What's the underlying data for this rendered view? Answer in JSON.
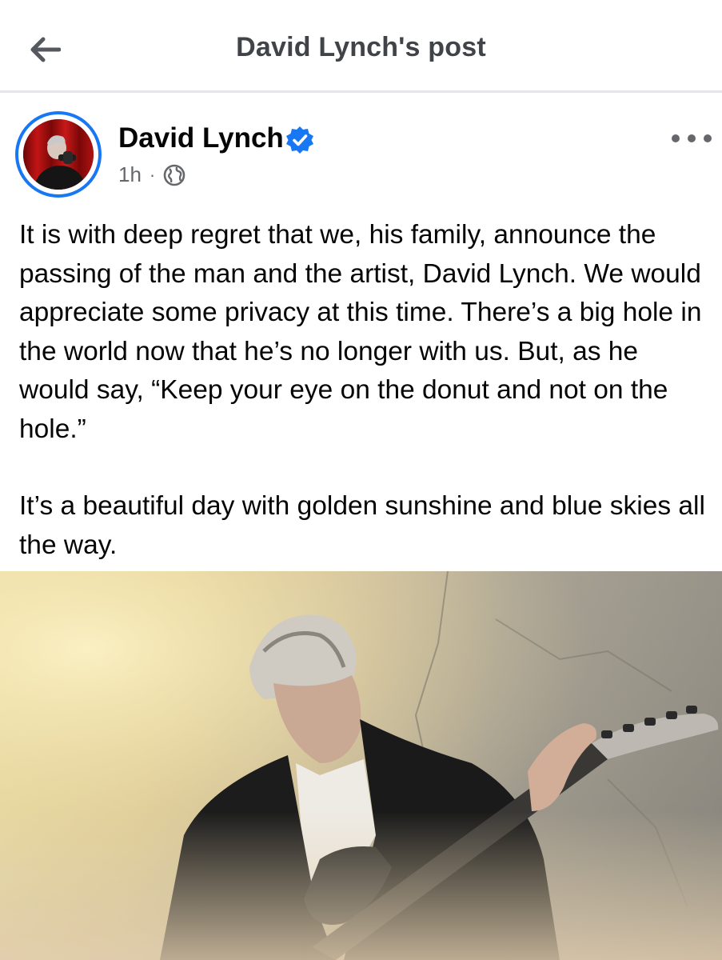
{
  "header": {
    "title": "David Lynch's post",
    "back_icon": "back-arrow-icon"
  },
  "post": {
    "author": "David Lynch",
    "verified": true,
    "timestamp": "1h",
    "separator": "·",
    "audience_icon": "globe-icon",
    "more_icon": "more-options-icon",
    "paragraphs": [
      "It is with deep regret that we, his family, announce the passing of the man and the artist, David Lynch. We would appreciate some privacy at this time. There’s a big hole in the world now that he’s no longer with us.  But, as he would say, “Keep your eye on the donut and not on the hole.”",
      "It’s a beautiful day with golden sunshine and blue skies all the way."
    ]
  },
  "colors": {
    "accent": "#1877f2",
    "title_text": "#404347",
    "secondary_text": "#65676b"
  }
}
